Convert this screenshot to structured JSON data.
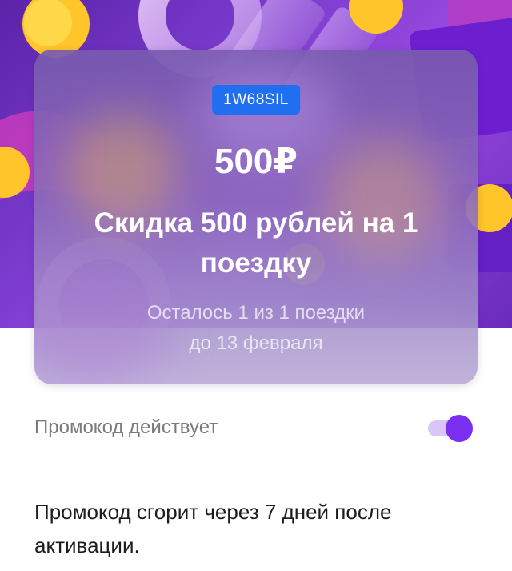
{
  "promo": {
    "code": "1W68SIL",
    "amount": "500₽",
    "headline": "Скидка 500 рублей на 1 поездку",
    "remaining": "Осталось 1 из 1 поездки",
    "valid_until": "до 13 февраля"
  },
  "toggle": {
    "label": "Промокод действует",
    "state": "on",
    "accent_color": "#7b2ff0"
  },
  "note": {
    "text": "Промокод сгорит через 7 дней после активации."
  },
  "colors": {
    "badge": "#1f6ff0",
    "hero": "#7c3ccf"
  }
}
